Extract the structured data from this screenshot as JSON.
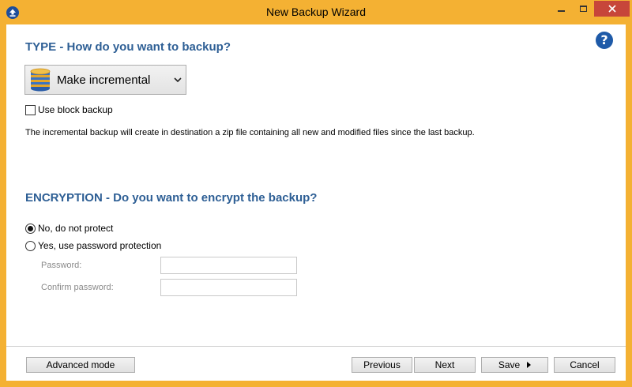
{
  "window": {
    "title": "New Backup Wizard",
    "icons": {
      "app": "app-upload-icon",
      "minimize": "minimize-icon",
      "maximize": "maximize-icon",
      "close": "close-icon"
    },
    "colors": {
      "titlebar": "#f4b133",
      "close_button": "#c7463a",
      "heading": "#2e5f95",
      "help": "#1e5aa8"
    }
  },
  "help": {
    "label": "?",
    "icon": "help-icon"
  },
  "type_section": {
    "title": "TYPE - How do you want to backup?",
    "dropdown": {
      "selected": "Make incremental",
      "icon": "database-icon",
      "arrow_icon": "chevron-down-icon"
    },
    "block_backup": {
      "label": "Use block backup",
      "checked": false
    },
    "description": "The incremental backup will create in destination a zip file containing all new and modified files since the last backup."
  },
  "encryption_section": {
    "title": "ENCRYPTION - Do you want to encrypt the backup?",
    "options": [
      {
        "label": "No, do not protect",
        "selected": true
      },
      {
        "label": "Yes, use password protection",
        "selected": false
      }
    ],
    "password_label": "Password:",
    "confirm_label": "Confirm password:",
    "password_value": "",
    "confirm_value": ""
  },
  "footer": {
    "advanced_label": "Advanced mode",
    "previous_label": "Previous",
    "next_label": "Next",
    "save_label": "Save",
    "save_arrow_icon": "triangle-right-icon",
    "cancel_label": "Cancel"
  }
}
